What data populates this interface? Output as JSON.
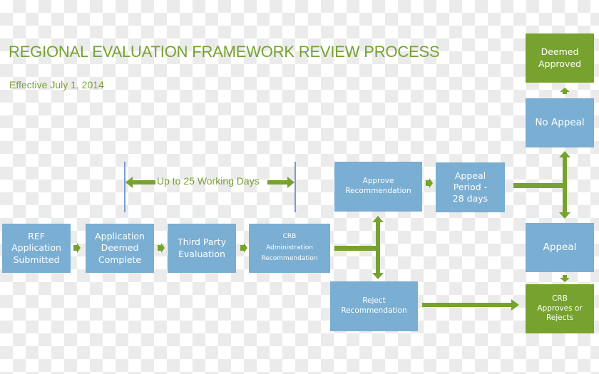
{
  "header": {
    "title": "REGIONAL EVALUATION FRAMEWORK REVIEW PROCESS",
    "subtitle": "Effective July 1, 2014"
  },
  "colors": {
    "accent_green": "#77a22f",
    "box_blue": "#7aaed2",
    "range_line_blue": "#4f7fc4",
    "text_on_box": "#ffffff"
  },
  "timeline": {
    "range_label": "Up to 25 Working Days"
  },
  "nodes": {
    "ref_submitted": "REF\nApplication\nSubmitted",
    "deemed_complete": "Application\nDeemed\nComplete",
    "third_party": "Third Party\nEvaluation",
    "crb_admin": "CRB\nAdministration\nRecommendation",
    "approve_rec": "Approve\nRecommendation",
    "reject_rec": "Reject\nRecommendation",
    "appeal_period": "Appeal\nPeriod -\n28 days",
    "no_appeal": "No Appeal",
    "deemed_approved": "Deemed\nApproved",
    "appeal": "Appeal",
    "crb_decides": "CRB\nApproves or\nRejects"
  }
}
